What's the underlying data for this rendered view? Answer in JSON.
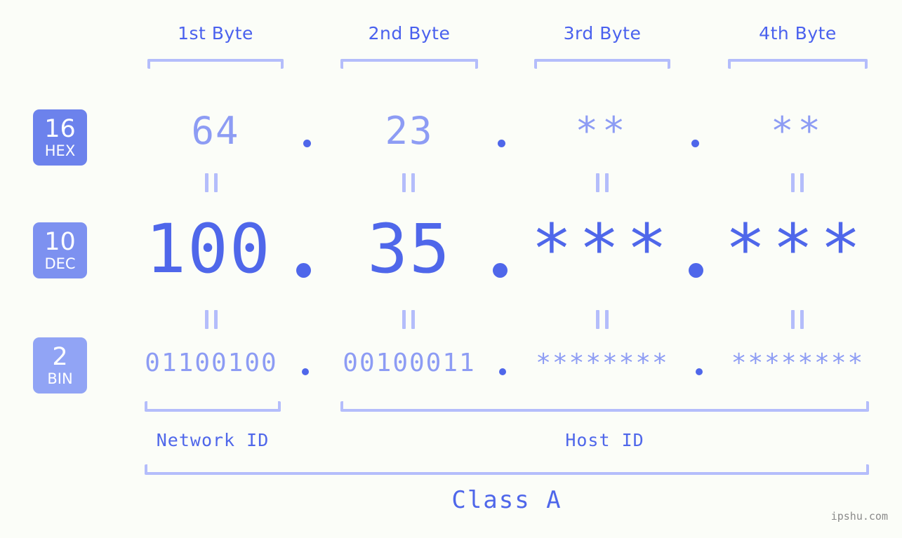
{
  "background_color": "#fbfdf8",
  "colors": {
    "accent_dark": "#4f67ea",
    "accent_mid": "#8d9cf4",
    "accent_light": "#b4bdfb",
    "header_text": "#4a61ee",
    "badge_hex": "#6c82ec",
    "badge_dec": "#7d91f0",
    "badge_bin": "#91a4f5",
    "watermark": "#8a8a8a"
  },
  "byte_headers": [
    {
      "label": "1st Byte"
    },
    {
      "label": "2nd Byte"
    },
    {
      "label": "3rd Byte"
    },
    {
      "label": "4th Byte"
    }
  ],
  "bases": [
    {
      "number": "16",
      "abbr": "HEX"
    },
    {
      "number": "10",
      "abbr": "DEC"
    },
    {
      "number": "2",
      "abbr": "BIN"
    }
  ],
  "rows": {
    "hex": {
      "base_number": "16",
      "base_abbr": "HEX",
      "values": [
        "64",
        "23",
        "**",
        "**"
      ],
      "separator": "."
    },
    "dec": {
      "base_number": "10",
      "base_abbr": "DEC",
      "values": [
        "100",
        "35",
        "***",
        "***"
      ],
      "separator": "."
    },
    "bin": {
      "base_number": "2",
      "base_abbr": "BIN",
      "values": [
        "01100100",
        "00100011",
        "********",
        "********"
      ],
      "separator": "."
    }
  },
  "equals_marks": {
    "glyph": "||",
    "count_per_gap": 4
  },
  "footer": {
    "network_id_label": "Network ID",
    "host_id_label": "Host ID",
    "class_label": "Class A"
  },
  "watermark": "ipshu.com"
}
